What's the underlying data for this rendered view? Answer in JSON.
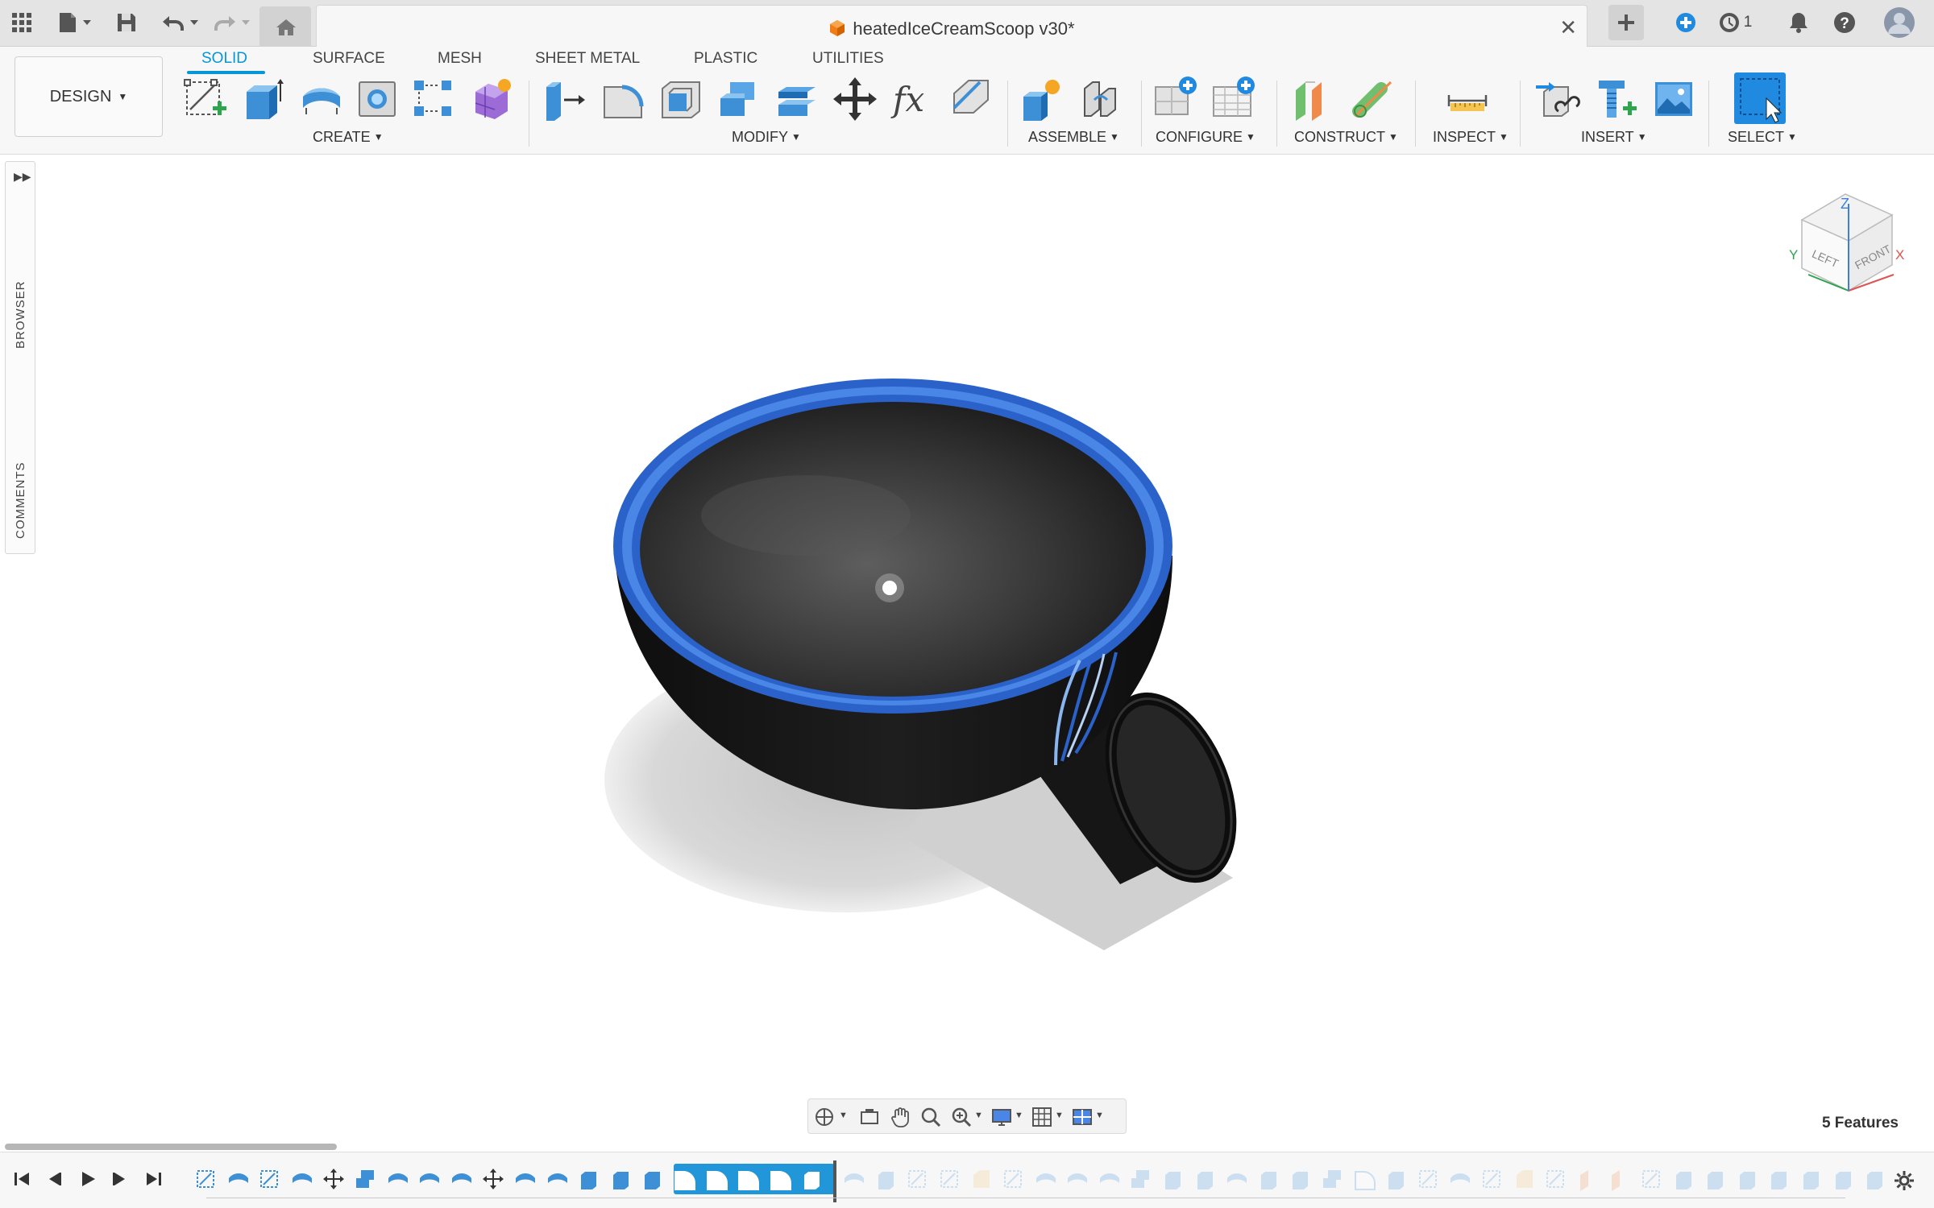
{
  "app": {
    "document_title": "heatedIceCreamScoop v30*",
    "notification_count": "1"
  },
  "workspace": {
    "design_label": "DESIGN"
  },
  "tabs": [
    {
      "label": "SOLID",
      "active": true
    },
    {
      "label": "SURFACE",
      "active": false
    },
    {
      "label": "MESH",
      "active": false
    },
    {
      "label": "SHEET METAL",
      "active": false
    },
    {
      "label": "PLASTIC",
      "active": false
    },
    {
      "label": "UTILITIES",
      "active": false
    }
  ],
  "groups": {
    "create": "CREATE",
    "modify": "MODIFY",
    "assemble": "ASSEMBLE",
    "configure": "CONFIGURE",
    "construct": "CONSTRUCT",
    "inspect": "INSPECT",
    "insert": "INSERT",
    "select": "SELECT"
  },
  "tools": {
    "create": [
      "create-sketch-icon",
      "extrude-icon",
      "revolve-icon",
      "hole-icon",
      "pattern-icon",
      "create-form-icon"
    ],
    "modify": [
      "press-pull-icon",
      "fillet-icon",
      "shell-icon",
      "combine-icon",
      "offset-face-icon",
      "move-icon",
      "parameters-icon",
      "split-icon"
    ],
    "assemble": [
      "new-component-icon",
      "joint-icon"
    ],
    "configure": [
      "configure-icon",
      "configuration-table-icon"
    ],
    "construct": [
      "offset-plane-icon",
      "axis-through-cylinder-icon"
    ],
    "inspect": [
      "measure-icon"
    ],
    "insert": [
      "insert-derive-icon",
      "insert-mcmaster-icon",
      "insert-canvas-icon"
    ],
    "select": [
      "window-select-icon"
    ]
  },
  "side_panels": {
    "browser": "BROWSER",
    "comments": "COMMENTS"
  },
  "view_cube": {
    "top": "Z",
    "left_face": "LEFT",
    "front_face": "FRONT",
    "axis_x": "X",
    "axis_y": "Y"
  },
  "status": {
    "features": "5 Features"
  },
  "colors": {
    "accent": "#0696d7",
    "timeline_selected": "#2196d8",
    "model_body": "#151515",
    "model_edge": "#2a62c9"
  }
}
